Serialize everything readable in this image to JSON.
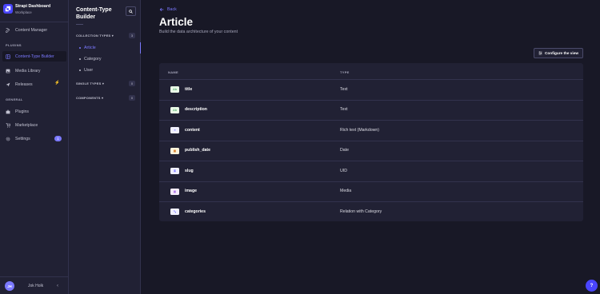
{
  "brand": {
    "title": "Strapi Dashboard",
    "subtitle": "Workplace"
  },
  "mainnav": {
    "content_manager": "Content Manager",
    "plugins_section": "PLUGINS",
    "ctb": "Content-Type Builder",
    "media_library": "Media Library",
    "releases": "Releases",
    "general_section": "GENERAL",
    "plugins": "Plugins",
    "marketplace": "Marketplace",
    "settings": "Settings",
    "settings_badge": "1",
    "user_initials": "JH",
    "user_name": "Jok Holk",
    "collapse": "‹"
  },
  "subnav": {
    "title": "Content-Type Builder",
    "collection_types": "COLLECTION TYPES",
    "collection_count": "3",
    "collections": [
      "Article",
      "Category",
      "User"
    ],
    "single_types": "SINGLE TYPES",
    "single_count": "0",
    "components": "COMPONENTS",
    "components_count": "0"
  },
  "main": {
    "back": "Back",
    "title": "Article",
    "subtitle": "Build the data architecture of your content",
    "configure": "Configure the view",
    "col_name": "NAME",
    "col_type": "TYPE",
    "help": "?"
  },
  "fields": [
    {
      "name": "title",
      "type": "Text",
      "icon": "Ab",
      "icon_name": "text-icon",
      "color": "#5cb176",
      "bg": "#eafbe7"
    },
    {
      "name": "description",
      "type": "Text",
      "icon": "Ab",
      "icon_name": "text-icon",
      "color": "#5cb176",
      "bg": "#eafbe7"
    },
    {
      "name": "content",
      "type": "Rich text (Markdown)",
      "icon": "≡",
      "icon_name": "richtext-icon",
      "color": "#4945ff",
      "bg": "#f0f0ff"
    },
    {
      "name": "publish_date",
      "type": "Date",
      "icon": "▦",
      "icon_name": "calendar-icon",
      "color": "#d9822f",
      "bg": "#fdf4dc"
    },
    {
      "name": "slug",
      "type": "UID",
      "icon": "⚿",
      "icon_name": "key-icon",
      "color": "#4945ff",
      "bg": "#f0f0ff"
    },
    {
      "name": "image",
      "type": "Media",
      "icon": "▣",
      "icon_name": "image-icon",
      "color": "#ac73e6",
      "bg": "#f6ecfc"
    },
    {
      "name": "categories",
      "type": "Relation with Category",
      "icon": "⤡",
      "icon_name": "relation-icon",
      "color": "#4945ff",
      "bg": "#f0f0ff"
    }
  ],
  "colors": {
    "accent": "#7b79ff",
    "primary": "#4945ff",
    "bg": "#181826",
    "panel": "#212134"
  }
}
